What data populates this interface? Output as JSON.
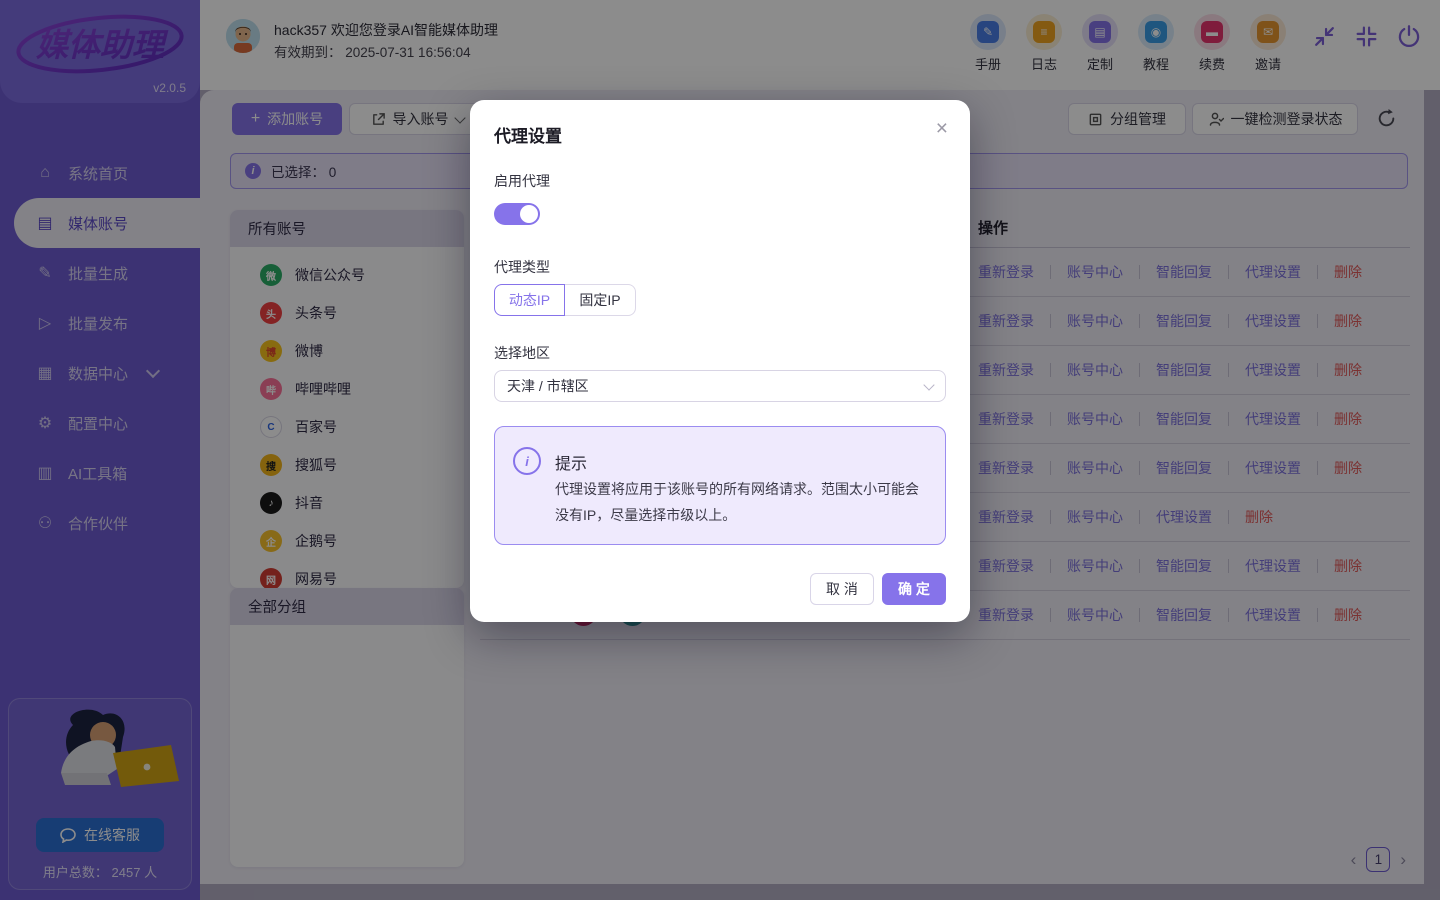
{
  "colors": {
    "accent": "#8673ea",
    "danger": "#e05a5a",
    "link": "#7d71dd",
    "sidebar": "#6e5cd2",
    "support_button": "#2b6fd4",
    "overlay": "rgba(0,0,0,0.45)"
  },
  "logo": {
    "text": "媒体助理",
    "version": "v2.0.5"
  },
  "header": {
    "welcome": "hack357 欢迎您登录AI智能媒体助理",
    "expiry": "有效期到： 2025-07-31 16:56:04",
    "quick_actions": [
      {
        "label": "手册",
        "icon": "manual-icon",
        "glyph": "✎",
        "color": "#4a7fe8",
        "bg": "#dbe7fb"
      },
      {
        "label": "日志",
        "icon": "log-icon",
        "glyph": "≡",
        "color": "#f0a51f",
        "bg": "#fbeed4"
      },
      {
        "label": "定制",
        "icon": "custom-icon",
        "glyph": "▤",
        "color": "#8673ea",
        "bg": "#e6e1fa"
      },
      {
        "label": "教程",
        "icon": "tutorial-icon",
        "glyph": "◉",
        "color": "#3a9de8",
        "bg": "#d9ecfb"
      },
      {
        "label": "续费",
        "icon": "renew-icon",
        "glyph": "▬",
        "color": "#e8336e",
        "bg": "#fbdce8"
      },
      {
        "label": "邀请",
        "icon": "invite-icon",
        "glyph": "✉",
        "color": "#e8962e",
        "bg": "#fbead6"
      }
    ]
  },
  "sidebar": {
    "items": [
      {
        "label": "系统首页",
        "icon": "home-icon",
        "glyph": "⌂"
      },
      {
        "label": "媒体账号",
        "icon": "media-accounts-icon",
        "glyph": "▤",
        "active": true
      },
      {
        "label": "批量生成",
        "icon": "batch-generate-icon",
        "glyph": "✎"
      },
      {
        "label": "批量发布",
        "icon": "batch-publish-icon",
        "glyph": "▷"
      },
      {
        "label": "数据中心",
        "icon": "data-center-icon",
        "glyph": "▦",
        "chevron": true
      },
      {
        "label": "配置中心",
        "icon": "config-center-icon",
        "glyph": "⚙"
      },
      {
        "label": "AI工具箱",
        "icon": "ai-toolbox-icon",
        "glyph": "▥"
      },
      {
        "label": "合作伙伴",
        "icon": "partners-icon",
        "glyph": "⚇"
      }
    ],
    "support_label": "在线客服",
    "users_total": "用户总数： 2457 人"
  },
  "toolbar": {
    "add_account": "添加账号",
    "import_account": "导入账号",
    "group_manage": "分组管理",
    "check_login": "一键检测登录状态"
  },
  "selection_bar": {
    "text": "已选择： 0"
  },
  "accounts_panel": {
    "title": "所有账号",
    "platforms": [
      {
        "name": "微信公众号",
        "icon": "wechat-icon",
        "glyph": "微",
        "bg": "#2aae67",
        "fg": "#ffffff"
      },
      {
        "name": "头条号",
        "icon": "toutiao-icon",
        "glyph": "头",
        "bg": "#f04142",
        "fg": "#ffffff"
      },
      {
        "name": "微博",
        "icon": "weibo-icon",
        "glyph": "博",
        "bg": "#f7c31e",
        "fg": "#e0482e"
      },
      {
        "name": "哔哩哔哩",
        "icon": "bilibili-icon",
        "glyph": "哔",
        "bg": "#fb7299",
        "fg": "#ffffff"
      },
      {
        "name": "百家号",
        "icon": "baijiahao-icon",
        "glyph": "C",
        "bg": "#ffffff",
        "fg": "#2d63e2"
      },
      {
        "name": "搜狐号",
        "icon": "sohu-icon",
        "glyph": "搜",
        "bg": "#f2b51a",
        "fg": "#222222"
      },
      {
        "name": "抖音",
        "icon": "douyin-icon",
        "glyph": "♪",
        "bg": "#1a1a1a",
        "fg": "#ffffff"
      },
      {
        "name": "企鹅号",
        "icon": "qie-icon",
        "glyph": "企",
        "bg": "#f7c12d",
        "fg": "#ffffff"
      },
      {
        "name": "网易号",
        "icon": "netease-icon",
        "glyph": "网",
        "bg": "#d43d33",
        "fg": "#ffffff"
      }
    ]
  },
  "groups_panel": {
    "title": "全部分组"
  },
  "table": {
    "operation_header": "操作",
    "rows": [
      {
        "actions": [
          "重新登录",
          "账号中心",
          "智能回复",
          "代理设置",
          "删除"
        ]
      },
      {
        "actions": [
          "重新登录",
          "账号中心",
          "智能回复",
          "代理设置",
          "删除"
        ]
      },
      {
        "actions": [
          "重新登录",
          "账号中心",
          "智能回复",
          "代理设置",
          "删除"
        ]
      },
      {
        "actions": [
          "重新登录",
          "账号中心",
          "智能回复",
          "代理设置",
          "删除"
        ]
      },
      {
        "actions": [
          "重新登录",
          "账号中心",
          "智能回复",
          "代理设置",
          "删除"
        ]
      },
      {
        "actions": [
          "重新登录",
          "账号中心",
          "代理设置",
          "删除"
        ]
      },
      {
        "actions": [
          "重新登录",
          "账号中心",
          "智能回复",
          "代理设置",
          "删除"
        ]
      },
      {
        "actions": [
          "重新登录",
          "账号中心",
          "智能回复",
          "代理设置",
          "删除"
        ],
        "avatars": [
          {
            "name": "account-avatar-red",
            "color": "#c2255c"
          },
          {
            "name": "account-avatar-teal",
            "color": "#2f8f8f"
          }
        ]
      }
    ]
  },
  "pagination": {
    "prev": "‹",
    "current": "1",
    "next": "›"
  },
  "modal": {
    "title": "代理设置",
    "enable_label": "启用代理",
    "enabled": true,
    "type_label": "代理类型",
    "type_options": [
      {
        "label": "动态IP",
        "selected": true
      },
      {
        "label": "固定IP",
        "selected": false
      }
    ],
    "region_label": "选择地区",
    "region_value": "天津 / 市辖区",
    "tip_title": "提示",
    "tip_body": "代理设置将应用于该账号的所有网络请求。范围太小可能会没有IP，尽量选择市级以上。",
    "cancel_label": "取 消",
    "confirm_label": "确 定"
  }
}
